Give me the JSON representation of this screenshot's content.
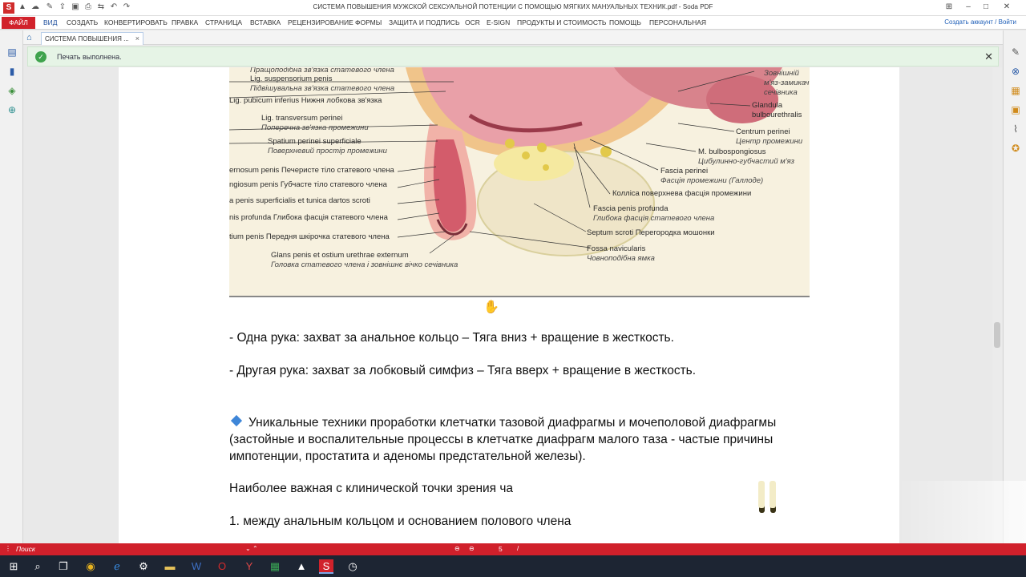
{
  "app": {
    "logo_letter": "S",
    "title": "СИСТЕМА ПОВЫШЕНИЯ МУЖСКОЙ СЕКСУАЛЬНОЙ ПОТЕНЦИИ С ПОМОЩЬЮ МЯГКИХ МАНУАЛЬНЫХ ТЕХНИК.pdf  -  Soda PDF"
  },
  "menu": {
    "file": "ФАЙЛ",
    "items": [
      "ВИД",
      "СОЗДАТЬ",
      "КОНВЕРТИРОВАТЬ",
      "ПРАВКА",
      "СТРАНИЦА",
      "ВСТАВКА",
      "РЕЦЕНЗИРОВАНИЕ",
      "ФОРМЫ",
      "ЗАЩИТА И ПОДПИСЬ",
      "OCR",
      "E-SIGN",
      "ПРОДУКТЫ И СТОИМОСТЬ",
      "ПОМОЩЬ",
      "ПЕРСОНАЛЬНАЯ"
    ],
    "account": "Создать аккаунт / Войти"
  },
  "tab": {
    "label": "СИСТЕМА ПОВЫШЕНИЯ ...",
    "close": "×"
  },
  "notification": {
    "message": "Печать выполнена.",
    "close": "✕"
  },
  "figure": {
    "labels_left": [
      {
        "lat": "Пращоподібна зв'язка статевого члена",
        "italic": true
      },
      {
        "lat": "Lig. suspensorium penis",
        "italic": false
      },
      {
        "lat": "Підвішувальна зв'язка статевого члена",
        "italic": true
      },
      {
        "lat": "Lig. pubicum inferius Нижня лобкова зв'язка",
        "italic": false
      },
      {
        "lat": "Lig. transversum perinei",
        "italic": false
      },
      {
        "lat": "Поперечна зв'язка промежини",
        "italic": true
      },
      {
        "lat": "Spatium perinei superficiale",
        "italic": false
      },
      {
        "lat": "Поверхневий простір промежини",
        "italic": true
      },
      {
        "lat": "ernosum penis Печеристе тіло статевого члена",
        "italic": false
      },
      {
        "lat": "ngiosum penis Губчасте тіло статевого члена",
        "italic": false
      },
      {
        "lat": "a penis superficialis et tunica dartos scroti",
        "italic": false
      },
      {
        "lat": "nis profunda Глибока фасція статевого члена",
        "italic": false
      },
      {
        "lat": "tium penis Передня шкірочка статевого члена",
        "italic": false
      },
      {
        "lat": "Glans penis et ostium urethrae externum",
        "italic": false
      },
      {
        "lat": "Головка статевого члена і зовнішнє вічко сечівника",
        "italic": true
      }
    ],
    "labels_right": [
      {
        "lat": "Зовнішній",
        "italic": true
      },
      {
        "lat": "м'яз-замикач",
        "italic": true
      },
      {
        "lat": "сечівника",
        "italic": true
      },
      {
        "lat": "Glandula",
        "italic": false
      },
      {
        "lat": "bulbourethralis",
        "italic": false
      },
      {
        "lat": "Centrum perinei",
        "italic": false
      },
      {
        "lat": "Центр промежини",
        "italic": true
      },
      {
        "lat": "M. bulbospongiosus",
        "italic": false
      },
      {
        "lat": "Цибулинно-губчастий м'яз",
        "italic": true
      },
      {
        "lat": "Fascia perinei",
        "italic": false
      },
      {
        "lat": "Фасція промежини (Галлоде)",
        "italic": true
      },
      {
        "lat": "Колліса поверхнева фасція промежини",
        "italic": false
      },
      {
        "lat": "Fascia penis profunda",
        "italic": false
      },
      {
        "lat": "Глибока фасція статевого члена",
        "italic": true
      },
      {
        "lat": "Septum scroti Перегородка мошонки",
        "italic": false
      },
      {
        "lat": "Fossa navicularis",
        "italic": false
      },
      {
        "lat": "Човноподібна ямка",
        "italic": true
      }
    ]
  },
  "document": {
    "p1": "- Одна рука: захват за анальное кольцо – Тяга вниз + вращение в жесткость.",
    "p2": "- Другая рука: захват за лобковый симфиз – Тяга вверх + вращение в жесткость.",
    "p3_line1": "Уникальные техники проработки клетчатки тазовой диафрагмы и мочеполовой диафрагмы",
    "p3_line2": "(застойные и воспалительные процессы в клетчатке диафрагм малого таза - частые причины",
    "p3_line3": "импотенции, простатита и аденомы предстательной железы).",
    "p4": "Наиболее важная с клинической точки зрения ча",
    "p5": "1. между анальным кольцом и основанием полового члена"
  },
  "status": {
    "search": "Поиск",
    "page": "5"
  },
  "colors": {
    "brand_red": "#d1222b",
    "accent_blue": "#1f4f9d",
    "notify_green": "#3fa34d",
    "taskbar": "#1d2533"
  }
}
